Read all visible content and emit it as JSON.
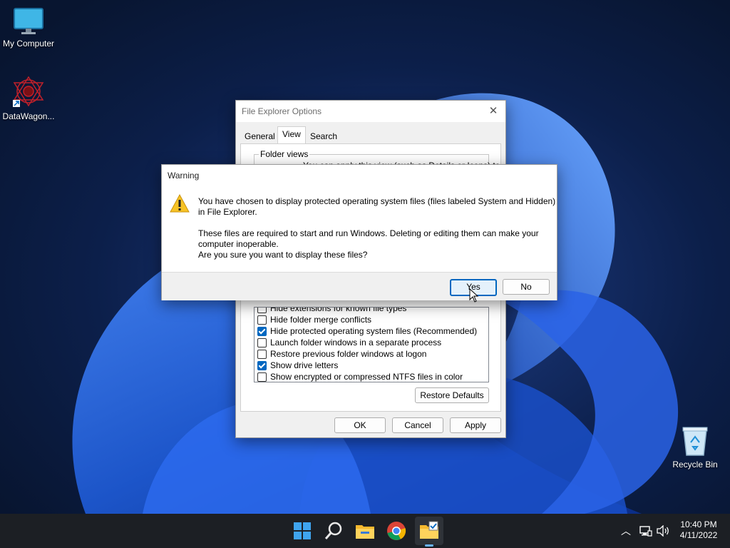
{
  "desktop": {
    "icons": [
      {
        "label": "My Computer"
      },
      {
        "label": "DataWagon..."
      },
      {
        "label": "Recycle Bin"
      }
    ]
  },
  "explorer_options": {
    "title": "File Explorer Options",
    "tabs": [
      {
        "label": "General"
      },
      {
        "label": "View"
      },
      {
        "label": "Search"
      }
    ],
    "active_tab": "View",
    "folder_views": {
      "label": "Folder views",
      "text_partial": "You can apply this view (such as Details or Icons) to"
    },
    "advanced": [
      {
        "label": "Hide extensions for known file types",
        "checked": false
      },
      {
        "label": "Hide folder merge conflicts",
        "checked": false
      },
      {
        "label": "Hide protected operating system files (Recommended)",
        "checked": true
      },
      {
        "label": "Launch folder windows in a separate process",
        "checked": false
      },
      {
        "label": "Restore previous folder windows at logon",
        "checked": false
      },
      {
        "label": "Show drive letters",
        "checked": true
      },
      {
        "label": "Show encrypted or compressed NTFS files in color",
        "checked": false
      }
    ],
    "restore_defaults": "Restore Defaults",
    "ok": "OK",
    "cancel": "Cancel",
    "apply": "Apply"
  },
  "warning": {
    "title": "Warning",
    "line1": "You have chosen to display protected operating system files (files labeled System and Hidden)",
    "line2": "in File Explorer.",
    "line3": "These files are required to start and run Windows. Deleting or editing them can make your",
    "line4": "computer inoperable.",
    "line5": "Are you sure you want to display these files?",
    "yes": "Yes",
    "no": "No"
  },
  "taskbar": {
    "apps": [
      {
        "icon": "windows-start-icon"
      },
      {
        "icon": "search-icon"
      },
      {
        "icon": "file-explorer-icon"
      },
      {
        "icon": "chrome-icon"
      },
      {
        "icon": "file-explorer-options-icon"
      }
    ],
    "time": "10:40 PM",
    "date": "4/11/2022"
  }
}
